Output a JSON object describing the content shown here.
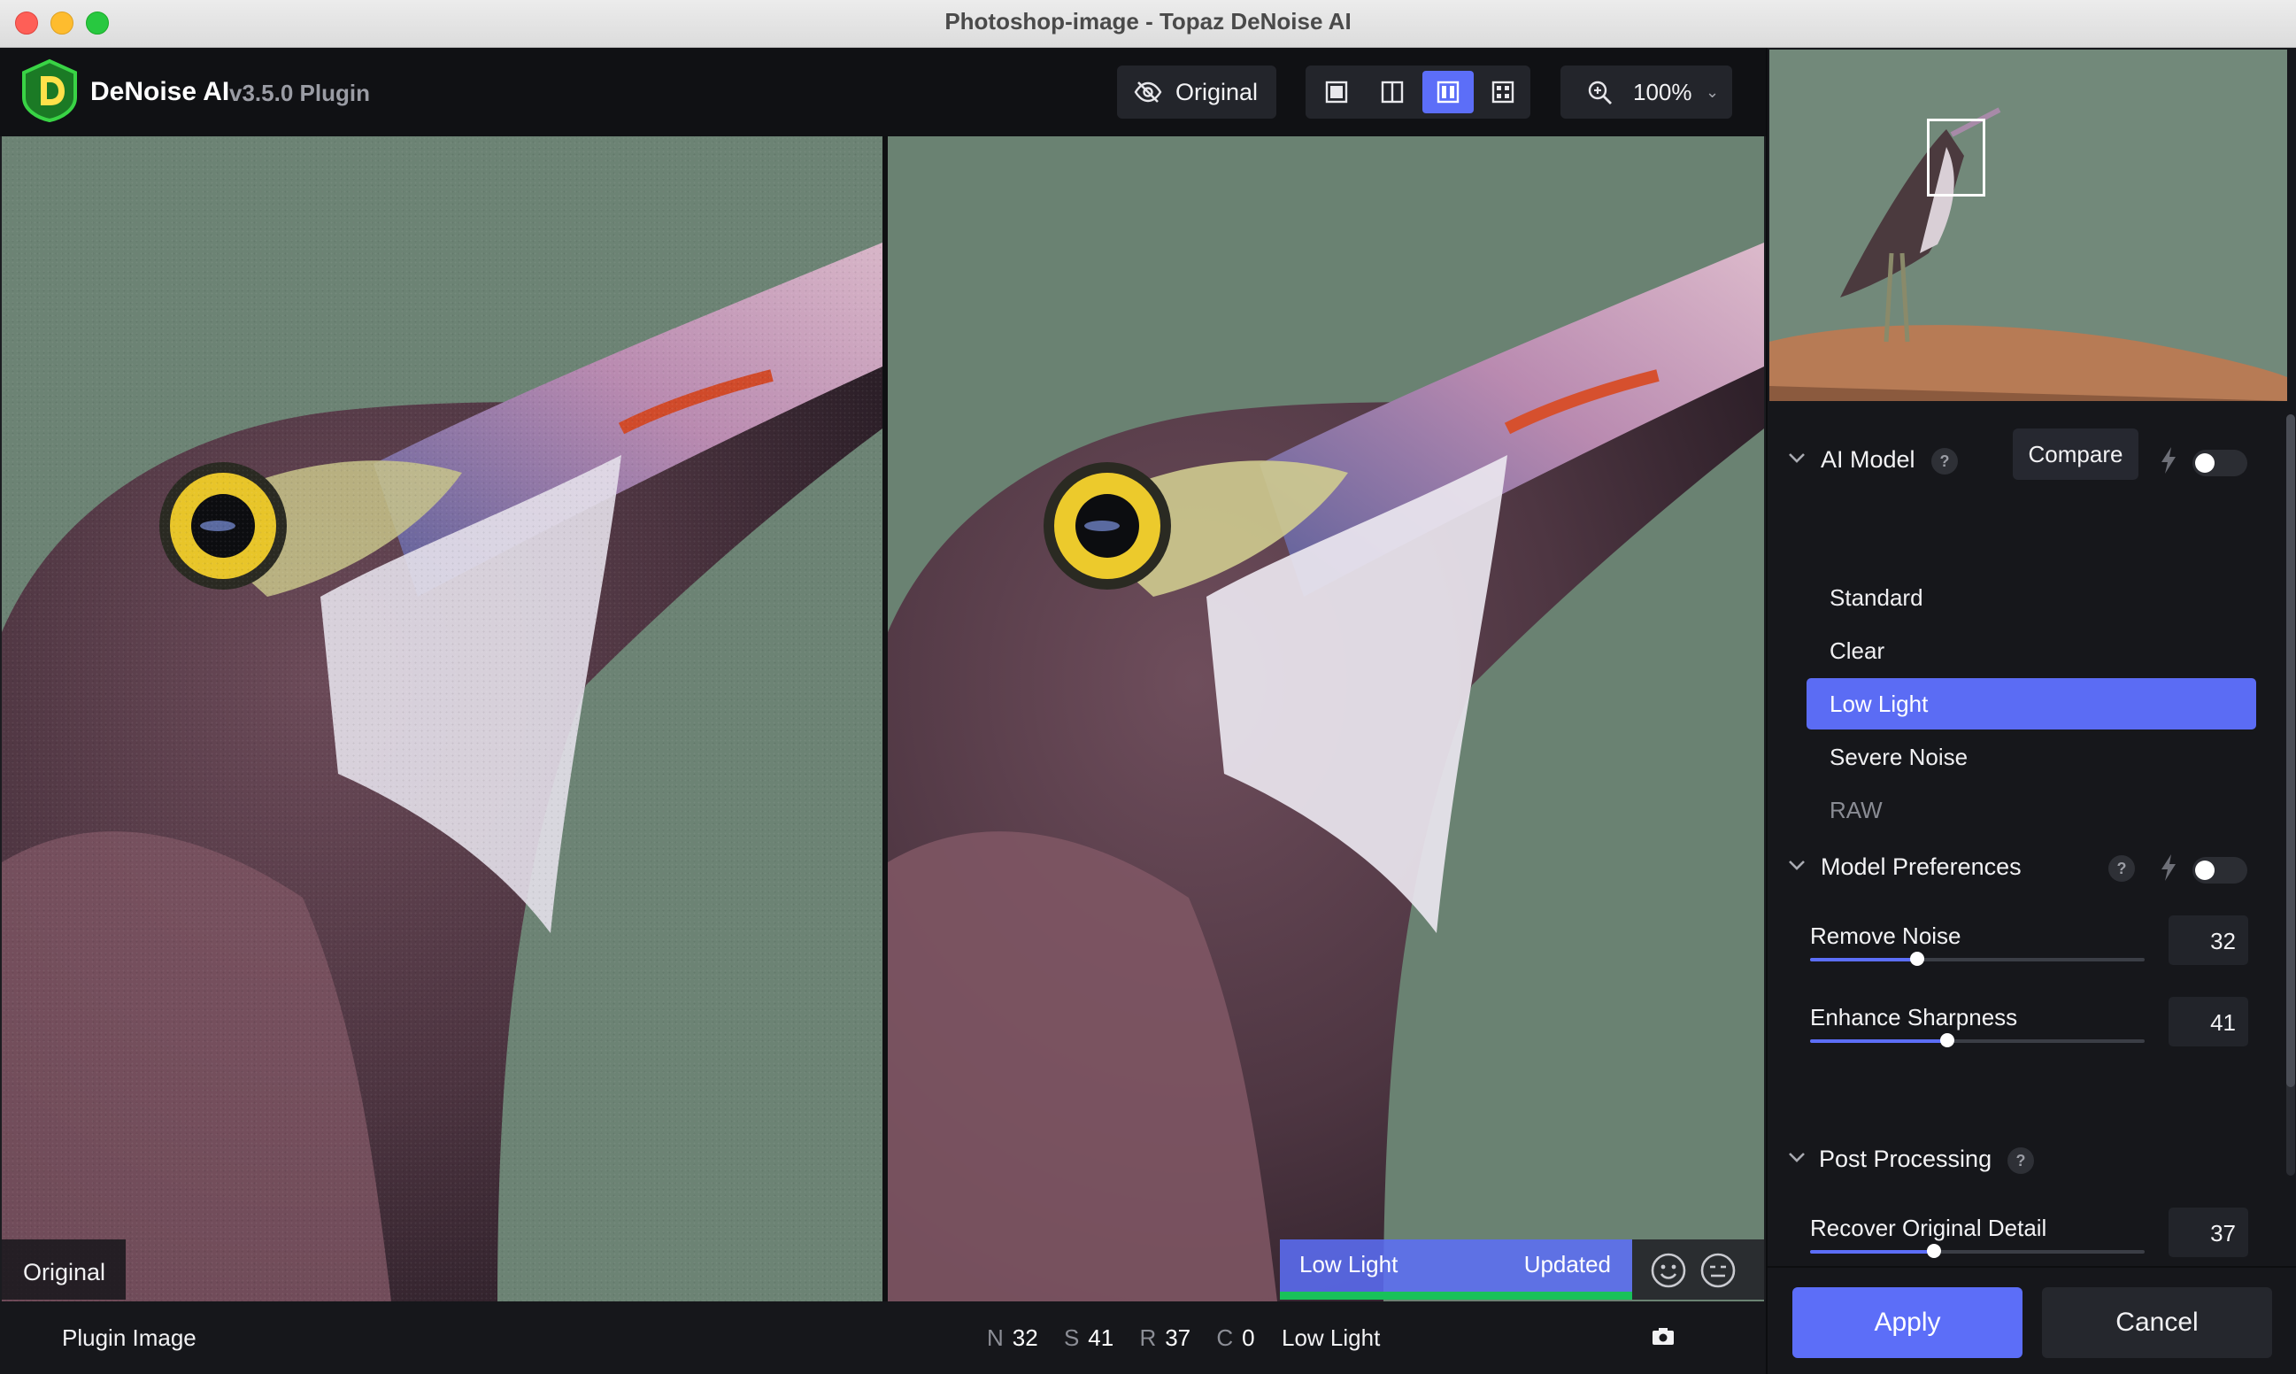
{
  "window": {
    "title": "Photoshop-image - Topaz DeNoise AI"
  },
  "app": {
    "name": "DeNoise AI",
    "version": "v3.5.0 Plugin",
    "logo_letter": "D"
  },
  "toolbar": {
    "original_label": "Original",
    "view_modes": [
      "single-view-icon",
      "split-view-icon",
      "side-by-side-icon",
      "quad-view-icon"
    ],
    "active_view": "side-by-side-icon",
    "zoom_label": "100%"
  },
  "canvas": {
    "left_tag": "Original",
    "right_tag_model": "Low Light",
    "right_tag_status": "Updated"
  },
  "statusbar": {
    "source_label": "Plugin Image",
    "stats": [
      {
        "key": "N",
        "value": "32"
      },
      {
        "key": "S",
        "value": "41"
      },
      {
        "key": "R",
        "value": "37"
      },
      {
        "key": "C",
        "value": "0"
      }
    ],
    "model": "Low Light"
  },
  "panel": {
    "ai_model": {
      "title": "AI Model",
      "help": "?",
      "compare_label": "Compare",
      "auto_enabled": false,
      "models": [
        {
          "label": "Standard",
          "state": "normal"
        },
        {
          "label": "Clear",
          "state": "normal"
        },
        {
          "label": "Low Light",
          "state": "active"
        },
        {
          "label": "Severe Noise",
          "state": "normal"
        },
        {
          "label": "RAW",
          "state": "disabled"
        }
      ]
    },
    "model_preferences": {
      "title": "Model Preferences",
      "help": "?",
      "auto_enabled": false,
      "remove_noise": {
        "label": "Remove Noise",
        "value": "32",
        "level": 0.32
      },
      "enhance_sharpness": {
        "label": "Enhance Sharpness",
        "value": "41",
        "level": 0.41
      }
    },
    "post_processing": {
      "title": "Post Processing",
      "help": "?",
      "recover_detail": {
        "label": "Recover Original Detail",
        "value": "37",
        "level": 0.37
      }
    },
    "apply_label": "Apply",
    "cancel_label": "Cancel"
  },
  "colors": {
    "accent": "#5c6ef8",
    "updated_bar": "#19c15a",
    "logo_green": "#2fbf3a"
  }
}
